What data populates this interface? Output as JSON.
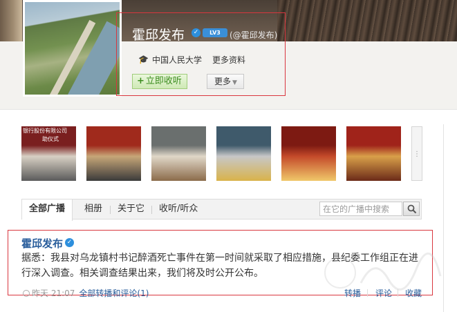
{
  "profile": {
    "name": "霍邱发布",
    "handle": "(@霍邱发布)",
    "level_badge": "LV3",
    "verified_icon": "verified-icon",
    "school": "中国人民大学",
    "more_info_link": "更多资料",
    "listen_button": "立即收听",
    "listen_plus": "+",
    "more_button": "更多",
    "edu_icon": "graduation-cap-icon"
  },
  "album": {
    "thumbnails": [
      {
        "caption": "银行股份有限公司",
        "subcaption": "助仪式",
        "colors": [
          "#7a1f1f",
          "#d8d0c4",
          "#5a5a5a"
        ]
      },
      {
        "caption": "",
        "subcaption": "",
        "colors": [
          "#a02a1c",
          "#c7a678",
          "#3a3a3a"
        ]
      },
      {
        "caption": "",
        "subcaption": "",
        "colors": [
          "#6a6f6e",
          "#e0d7c8",
          "#8b6b4a"
        ]
      },
      {
        "caption": "",
        "subcaption": "",
        "colors": [
          "#3f5a6b",
          "#c7c7c7",
          "#d9b34a"
        ]
      },
      {
        "caption": "",
        "subcaption": "",
        "colors": [
          "#7d1a12",
          "#c44a2a",
          "#f0c86a"
        ]
      },
      {
        "caption": "",
        "subcaption": "",
        "colors": [
          "#a0231a",
          "#d9a04a",
          "#6b2a18"
        ]
      }
    ],
    "more_label": "⋮"
  },
  "tabs": [
    {
      "label": "全部广播",
      "active": true
    },
    {
      "label": "相册",
      "active": false
    },
    {
      "label": "关于它",
      "active": false
    },
    {
      "label": "收听/听众",
      "active": false
    }
  ],
  "search": {
    "placeholder": "在它的广播中搜索",
    "icon": "search-icon"
  },
  "post": {
    "author": "霍邱发布",
    "text": "据悉：我县对乌龙镇村书记醉酒死亡事件在第一时间就采取了相应措施，县纪委工作组正在进行深入调查。相关调查结果出来，我们将及时公开公布。",
    "time": "昨天 21:07",
    "forward_comments_link": "全部转播和评论(1)",
    "actions": [
      "转播",
      "评论",
      "收藏"
    ]
  }
}
